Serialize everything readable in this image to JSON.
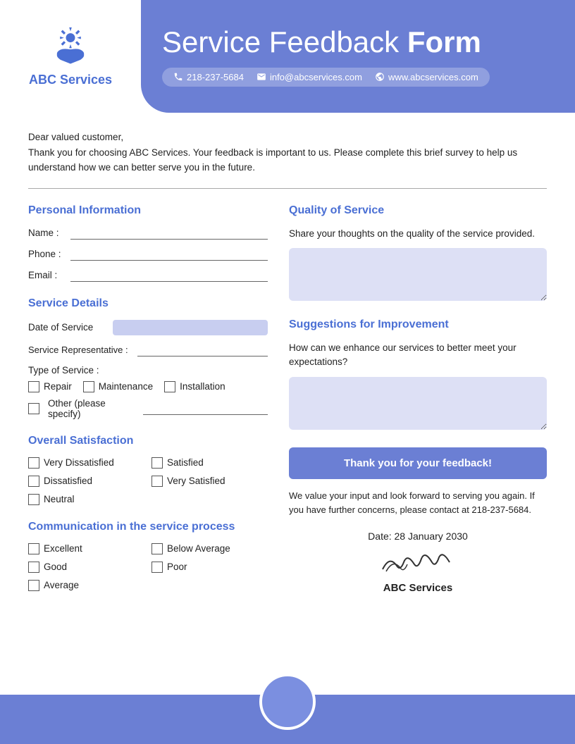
{
  "header": {
    "logo_text": "ABC Services",
    "title_light": "Service Feedback ",
    "title_bold": "Form",
    "phone": "218-237-5684",
    "email": "info@abcservices.com",
    "website": "www.abcservices.com"
  },
  "intro": {
    "line1": "Dear valued customer,",
    "line2": "Thank you for choosing ABC Services. Your feedback is important to us. Please complete this brief survey to help us understand how we can better serve you in the future."
  },
  "personal_info": {
    "title": "Personal Information",
    "name_label": "Name :",
    "phone_label": "Phone :",
    "email_label": "Email :"
  },
  "service_details": {
    "title": "Service Details",
    "date_label": "Date of Service",
    "rep_label": "Service Representative :",
    "type_label": "Type of Service :",
    "types": [
      "Repair",
      "Maintenance",
      "Installation"
    ],
    "other_label": "Other (please specify)"
  },
  "overall_satisfaction": {
    "title": "Overall Satisfaction",
    "options": [
      "Very Dissatisfied",
      "Satisfied",
      "Dissatisfied",
      "Very Satisfied",
      "Neutral"
    ]
  },
  "communication": {
    "title": "Communication in the service process",
    "options": [
      "Excellent",
      "Below Average",
      "Good",
      "Poor",
      "Average"
    ]
  },
  "quality": {
    "title": "Quality of Service",
    "desc": "Share your thoughts on the quality of the service provided."
  },
  "suggestions": {
    "title": "Suggestions for Improvement",
    "desc": "How can we enhance our services to better meet your expectations?"
  },
  "thankyou": {
    "box_text": "Thank you for your feedback!",
    "note": "We value your input and look forward to serving you again. If you have further concerns, please contact at 218-237-5684."
  },
  "signature": {
    "date_label": "Date: 28 January 2030",
    "company": "ABC Services"
  }
}
